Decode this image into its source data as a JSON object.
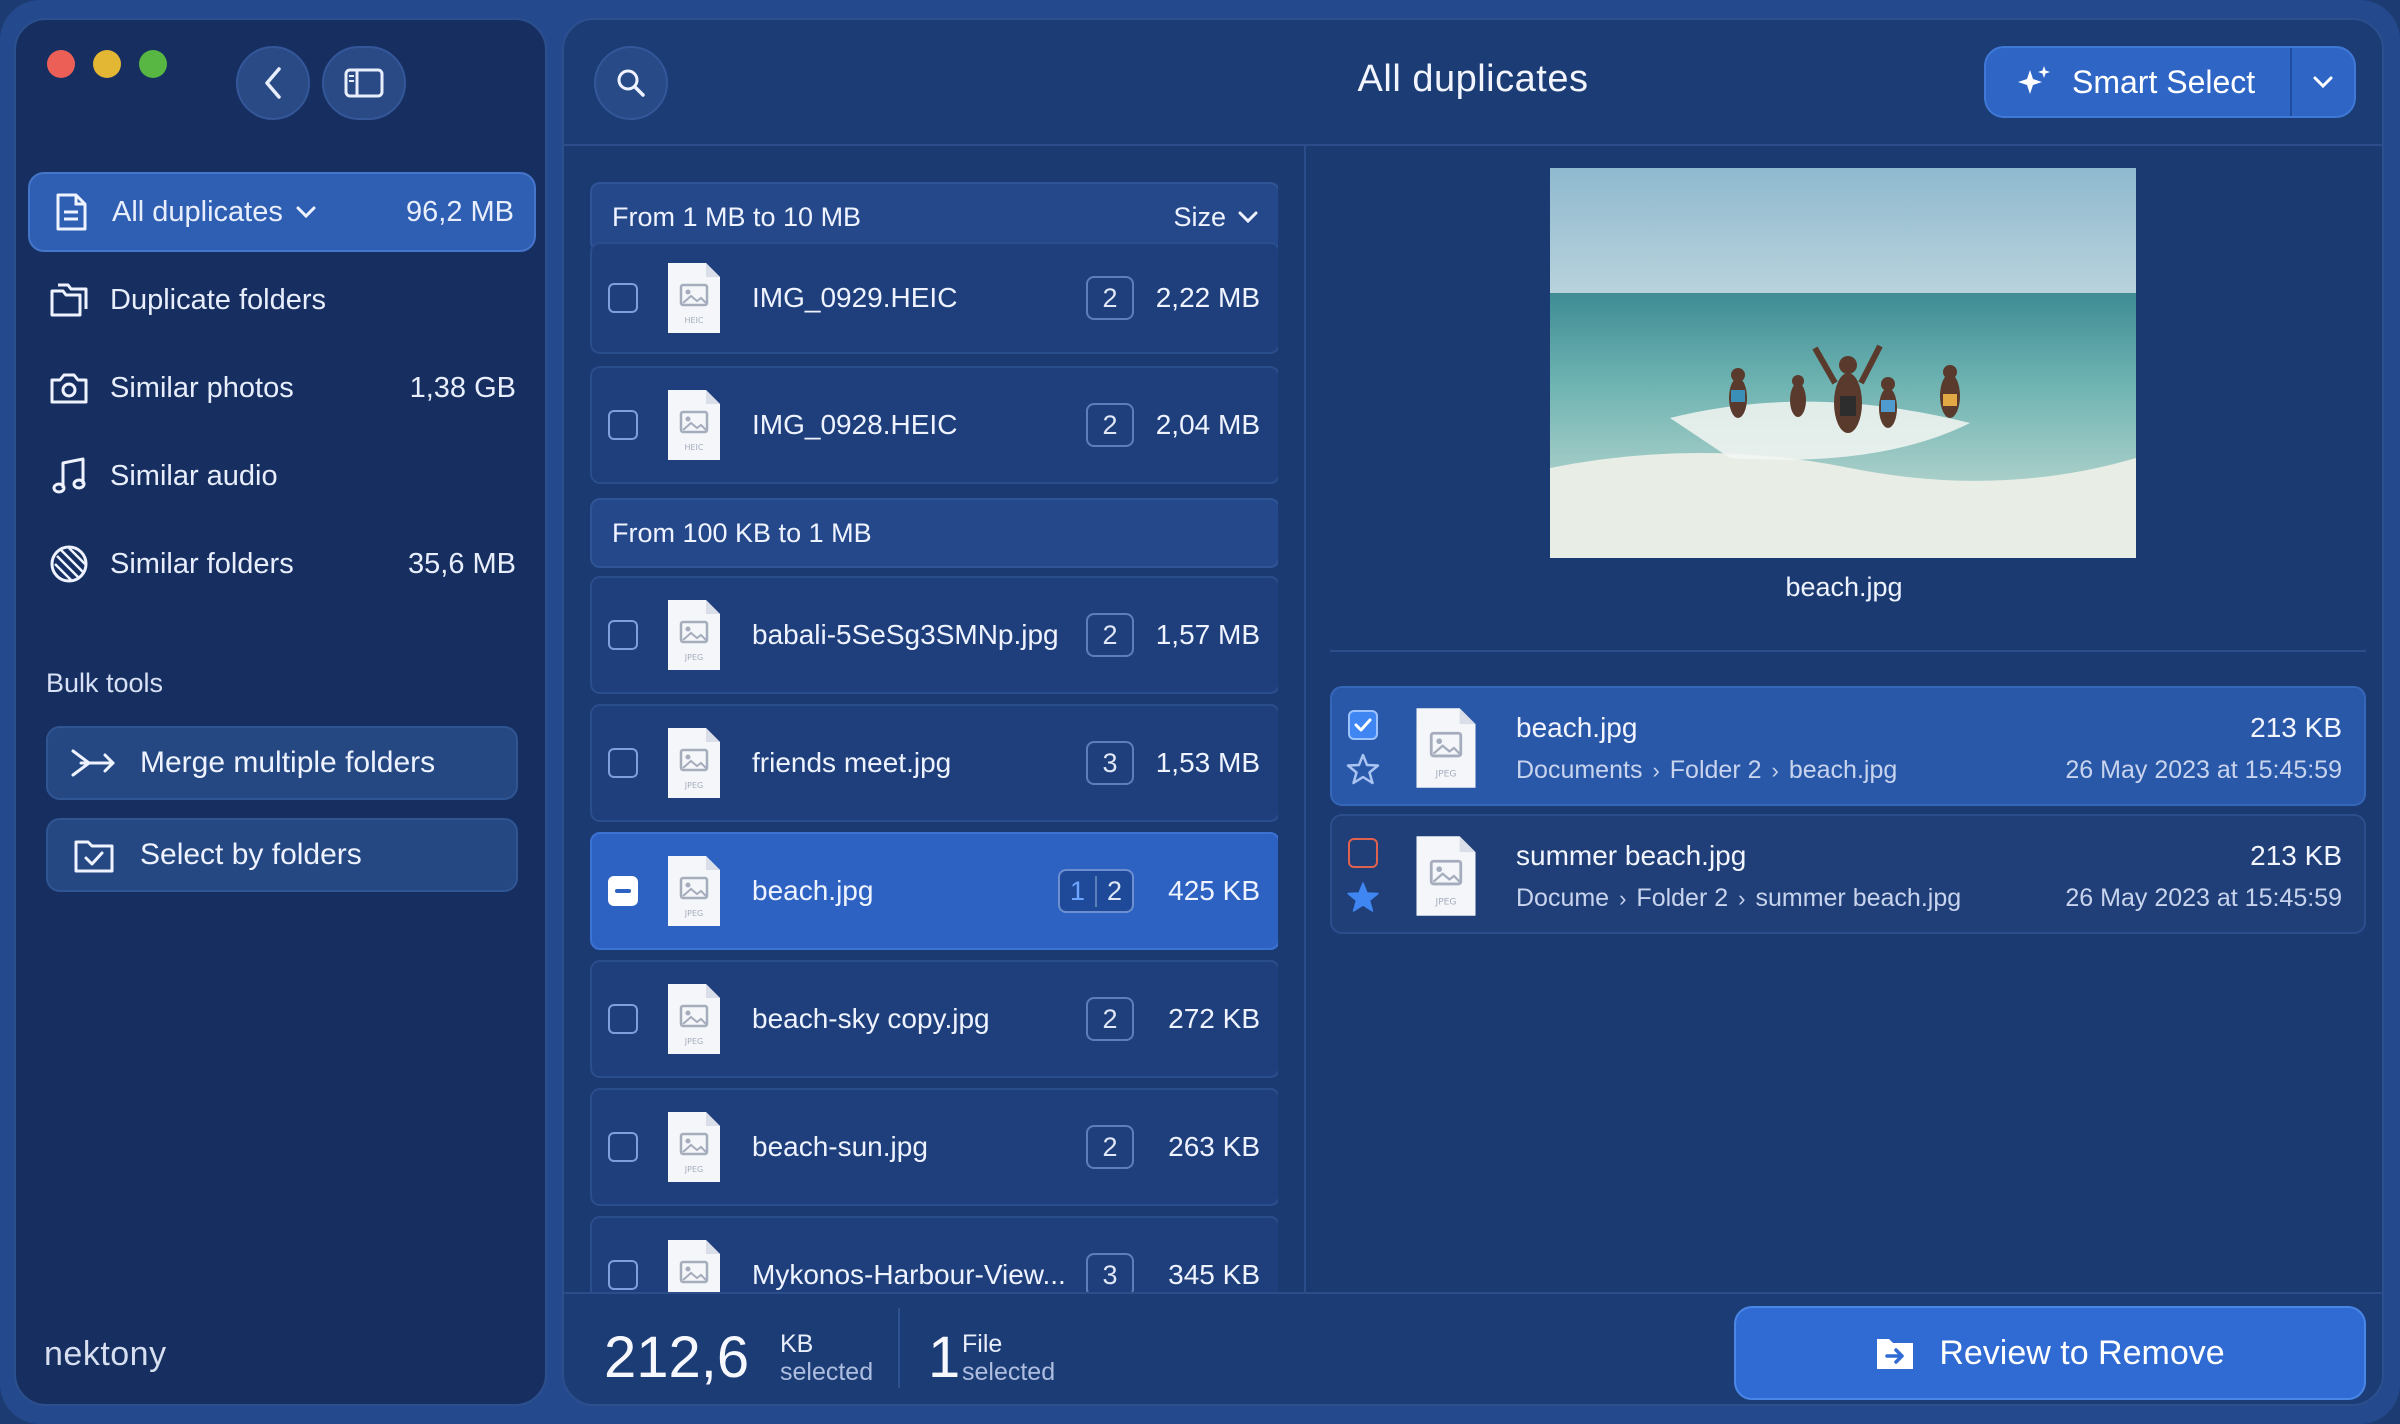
{
  "sidebar": {
    "items": [
      {
        "label": "All duplicates",
        "size": "96,2 MB",
        "icon": "document-icon"
      },
      {
        "label": "Duplicate folders",
        "size": "",
        "icon": "folders-icon"
      },
      {
        "label": "Similar photos",
        "size": "1,38 GB",
        "icon": "camera-icon"
      },
      {
        "label": "Similar audio",
        "size": "",
        "icon": "music-note-icon"
      },
      {
        "label": "Similar folders",
        "size": "35,6 MB",
        "icon": "similar-folders-icon"
      }
    ],
    "bulk_tools_label": "Bulk tools",
    "bulk_tools": [
      {
        "label": "Merge multiple folders",
        "icon": "merge-arrows-icon"
      },
      {
        "label": "Select by folders",
        "icon": "folder-check-icon"
      }
    ],
    "logo": "nektony"
  },
  "header": {
    "title": "All duplicates",
    "smart_select": "Smart Select"
  },
  "list": {
    "groups": [
      {
        "label": "From 1 MB to 10 MB",
        "sort": "Size"
      },
      {
        "label": "From 100 KB to 1 MB"
      }
    ],
    "files": [
      {
        "name": "IMG_0929.HEIC",
        "count": "2",
        "size": "2,22 MB",
        "type": "HEIC"
      },
      {
        "name": "IMG_0928.HEIC",
        "count": "2",
        "size": "2,04 MB",
        "type": "HEIC"
      },
      {
        "name": "babali-5SeSg3SMNp.jpg",
        "count": "2",
        "size": "1,57 MB",
        "type": "JPEG"
      },
      {
        "name": "friends meet.jpg",
        "count": "3",
        "size": "1,53 MB",
        "type": "JPEG"
      },
      {
        "name": "beach.jpg",
        "count_selected": "1",
        "count": "2",
        "size": "425 KB",
        "type": "JPEG"
      },
      {
        "name": "beach-sky copy.jpg",
        "count": "2",
        "size": "272 KB",
        "type": "JPEG"
      },
      {
        "name": "beach-sun.jpg",
        "count": "2",
        "size": "263 KB",
        "type": "JPEG"
      },
      {
        "name": "Mykonos-Harbour-View...",
        "count": "3",
        "size": "345 KB",
        "type": "JPEG"
      }
    ]
  },
  "preview": {
    "file_name": "beach.jpg",
    "copies": [
      {
        "name": "beach.jpg",
        "size": "213 KB",
        "path": [
          "Documents",
          "Folder 2",
          "beach.jpg"
        ],
        "date": "26 May 2023 at 15:45:59",
        "checked": true,
        "type": "JPEG"
      },
      {
        "name": "summer beach.jpg",
        "size": "213 KB",
        "path": [
          "Docume",
          "Folder 2",
          "summer beach.jpg"
        ],
        "date": "26 May 2023 at 15:45:59",
        "checked": false,
        "type": "JPEG"
      }
    ]
  },
  "footer": {
    "selected_size": "212,6",
    "selected_size_unit": "KB",
    "selected_size_caption": "selected",
    "selected_count": "1",
    "selected_count_unit": "File",
    "selected_count_caption": "selected",
    "review_button": "Review to Remove"
  },
  "colors": {
    "background": "#244a8d",
    "sidebar": "#162f60",
    "accent": "#2f6bd2",
    "selected_row": "#2d62c2",
    "checkbox_on": "#3f86f3",
    "checkbox_warning": "#e0614d"
  }
}
